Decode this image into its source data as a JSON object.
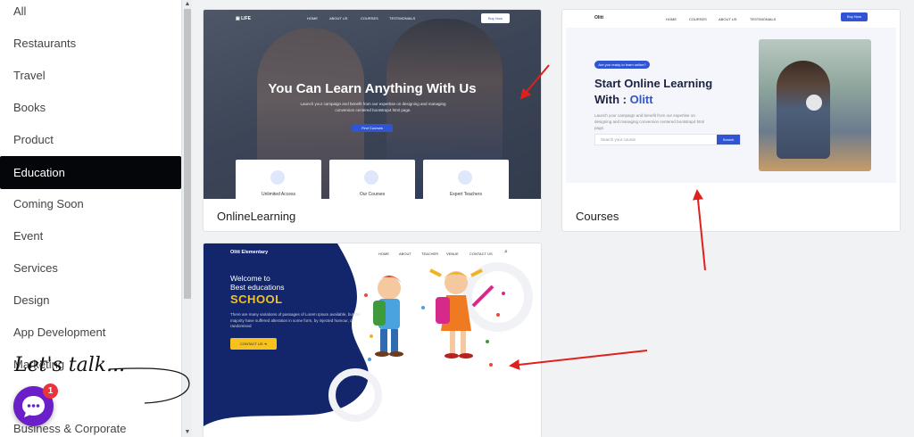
{
  "sidebar": {
    "items": [
      {
        "label": "All"
      },
      {
        "label": "Restaurants"
      },
      {
        "label": "Travel"
      },
      {
        "label": "Books"
      },
      {
        "label": "Product"
      },
      {
        "label": "Education"
      },
      {
        "label": "Coming Soon"
      },
      {
        "label": "Event"
      },
      {
        "label": "Services"
      },
      {
        "label": "Design"
      },
      {
        "label": "App Development"
      },
      {
        "label": "Marketing"
      },
      {
        "label": "Business & Corporate"
      }
    ],
    "active_item": "Education"
  },
  "chat": {
    "tagline": "Let's talk...",
    "badge_count": "1",
    "accent_color": "#6a1fc8",
    "badge_color": "#e8343a"
  },
  "templates": [
    {
      "title": "OnlineLearning",
      "preview": {
        "nav": [
          "HOME",
          "ABOUT US",
          "COURSES",
          "TESTIMONIALS"
        ],
        "buy_label": "Buy Now",
        "headline": "You Can Learn Anything With Us",
        "subtext": "Launch your campaign and benefit from our expertise on designing and managing conversion centered bootstrap4 html page.",
        "button": "Find Courses",
        "features": [
          "Unlimited Access",
          "Our Courses",
          "Expert Teachers"
        ]
      }
    },
    {
      "title": "Courses",
      "preview": {
        "logo": "Olitt",
        "nav": [
          "HOME",
          "COURSES",
          "ABOUT US",
          "TESTIMONIALS"
        ],
        "buy_label": "Buy Now",
        "chip": "Are you ready to learn online?",
        "headline_line1": "Start Online Learning",
        "headline_line2_prefix": "With : ",
        "headline_accent": "Olitt",
        "subtext": "Launch your campaign and benefit from our expertise on designing and managing conversion centered bootstrap4 html page.",
        "search_placeholder": "Search your course",
        "search_button": "Search"
      }
    },
    {
      "title": "",
      "preview": {
        "brand": "Olitt Elementary",
        "nav": [
          "HOME",
          "ABOUT",
          "TEACHER",
          "VENUE",
          "CONTACT US"
        ],
        "welcome_line1": "Welcome to",
        "welcome_line2": "Best educations",
        "headline": "SCHOOL",
        "subtext": "There are many variations of passages of Lorem Ipsum available, but the majority have suffered alteration in some form, by injected humour, or randomised",
        "button": "CONTACT US"
      }
    }
  ],
  "colors": {
    "primary_blue": "#2f55d4",
    "navy": "#13266b",
    "yellow": "#f7c21b",
    "annotation_red": "#e0201c"
  }
}
